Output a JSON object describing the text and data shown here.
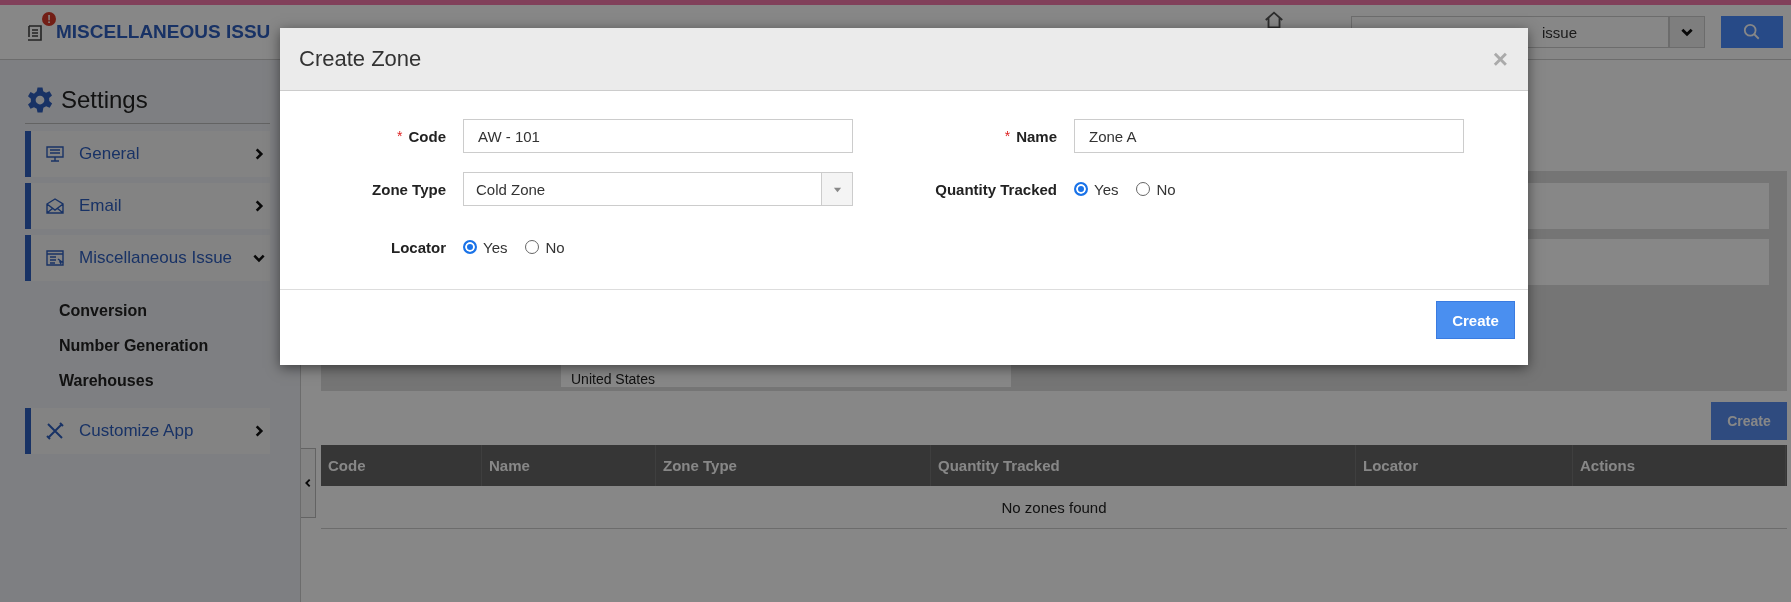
{
  "header": {
    "title": "MISCELLANEOUS ISSU",
    "notification": "!",
    "search": {
      "placeholder": "issue"
    }
  },
  "sidebar": {
    "title": "Settings",
    "items": [
      {
        "label": "General",
        "expanded": false
      },
      {
        "label": "Email",
        "expanded": false
      },
      {
        "label": "Miscellaneous Issue",
        "expanded": true,
        "children": [
          "Conversion",
          "Number Generation",
          "Warehouses"
        ]
      },
      {
        "label": "Customize App",
        "expanded": false
      }
    ]
  },
  "content": {
    "address_line": "United States",
    "create_button": "Create",
    "table": {
      "columns": [
        "Code",
        "Name",
        "Zone Type",
        "Quantity Tracked",
        "Locator",
        "Actions"
      ],
      "empty_text": "No zones found"
    }
  },
  "modal": {
    "title": "Create Zone",
    "close": "×",
    "fields": [
      {
        "kind": "text",
        "label": "Code",
        "required_mark": "*",
        "value": "AW - 101"
      },
      {
        "kind": "text",
        "label": "Name",
        "required_mark": "*",
        "value": "Zone A"
      },
      {
        "kind": "select",
        "label": "Zone Type",
        "value": "Cold Zone"
      },
      {
        "kind": "radio",
        "label": "Quantity Tracked",
        "options": [
          {
            "label": "Yes",
            "selected": true
          },
          {
            "label": "No",
            "selected": false
          }
        ]
      },
      {
        "kind": "radio",
        "label": "Locator",
        "options": [
          {
            "label": "Yes",
            "selected": true
          },
          {
            "label": "No",
            "selected": false
          }
        ]
      }
    ],
    "button": "Create"
  }
}
